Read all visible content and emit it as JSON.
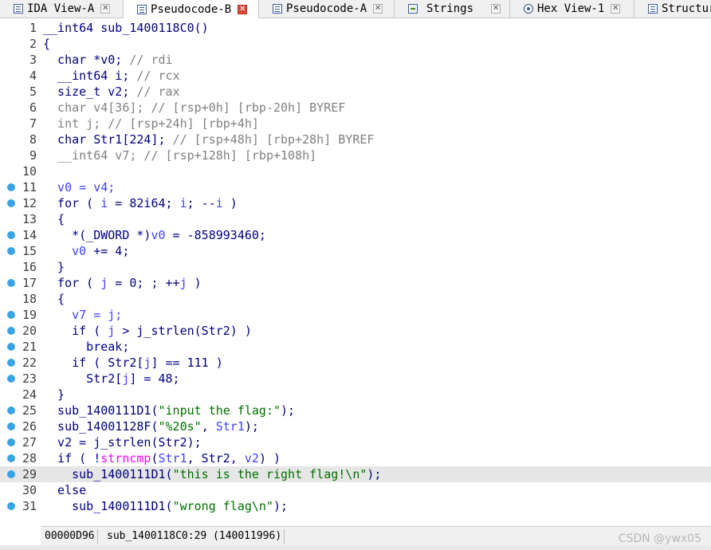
{
  "tabs": [
    {
      "label": "IDA View-A",
      "icon": "listing-icon",
      "active": false
    },
    {
      "label": "Pseudocode-B",
      "icon": "pseudocode-icon",
      "active": true
    },
    {
      "label": "Pseudocode-A",
      "icon": "pseudocode-icon",
      "active": false
    },
    {
      "label": "Strings",
      "icon": "strings-icon",
      "active": false
    },
    {
      "label": "Hex View-1",
      "icon": "hex-icon",
      "active": false
    },
    {
      "label": "Structur",
      "icon": "structures-icon",
      "active": false
    }
  ],
  "colors": {
    "keyword": "#000080",
    "comment": "#808080",
    "variable": "#4040ff",
    "string": "#007000",
    "imported": "#ff00ff",
    "breakpoint": "#3aa3e3",
    "current_line": "#e6e6e6"
  },
  "lines": [
    {
      "n": "1",
      "bp": false,
      "cur": false,
      "tokens": [
        [
          "k",
          "__int64 sub_1400118C0()"
        ]
      ]
    },
    {
      "n": "2",
      "bp": false,
      "cur": false,
      "tokens": [
        [
          "k",
          "{"
        ]
      ]
    },
    {
      "n": "3",
      "bp": false,
      "cur": false,
      "tokens": [
        [
          "k",
          "  char *v0; "
        ],
        [
          "g",
          "// rdi"
        ]
      ]
    },
    {
      "n": "4",
      "bp": false,
      "cur": false,
      "tokens": [
        [
          "k",
          "  __int64 i; "
        ],
        [
          "g",
          "// rcx"
        ]
      ]
    },
    {
      "n": "5",
      "bp": false,
      "cur": false,
      "tokens": [
        [
          "k",
          "  size_t v2; "
        ],
        [
          "g",
          "// rax"
        ]
      ]
    },
    {
      "n": "6",
      "bp": false,
      "cur": false,
      "tokens": [
        [
          "g",
          "  char v4[36]; // [rsp+0h] [rbp-20h] BYREF"
        ]
      ]
    },
    {
      "n": "7",
      "bp": false,
      "cur": false,
      "tokens": [
        [
          "g",
          "  int j; // [rsp+24h] [rbp+4h]"
        ]
      ]
    },
    {
      "n": "8",
      "bp": false,
      "cur": false,
      "tokens": [
        [
          "k",
          "  char Str1[224]; "
        ],
        [
          "g",
          "// [rsp+48h] [rbp+28h] BYREF"
        ]
      ]
    },
    {
      "n": "9",
      "bp": false,
      "cur": false,
      "tokens": [
        [
          "g",
          "  __int64 v7; // [rsp+128h] [rbp+108h]"
        ]
      ]
    },
    {
      "n": "10",
      "bp": false,
      "cur": false,
      "tokens": []
    },
    {
      "n": "11",
      "bp": true,
      "cur": false,
      "tokens": [
        [
          "v",
          "  v0 = v4;"
        ]
      ]
    },
    {
      "n": "12",
      "bp": true,
      "cur": false,
      "tokens": [
        [
          "k",
          "  for ( "
        ],
        [
          "v",
          "i"
        ],
        [
          "k",
          " = 82i64; "
        ],
        [
          "v",
          "i"
        ],
        [
          "k",
          "; --"
        ],
        [
          "v",
          "i"
        ],
        [
          "k",
          " )"
        ]
      ]
    },
    {
      "n": "13",
      "bp": false,
      "cur": false,
      "tokens": [
        [
          "k",
          "  {"
        ]
      ]
    },
    {
      "n": "14",
      "bp": true,
      "cur": false,
      "tokens": [
        [
          "k",
          "    *(_DWORD *)"
        ],
        [
          "v",
          "v0"
        ],
        [
          "k",
          " = -858993460;"
        ]
      ]
    },
    {
      "n": "15",
      "bp": true,
      "cur": false,
      "tokens": [
        [
          "v",
          "    v0"
        ],
        [
          "k",
          " += 4;"
        ]
      ]
    },
    {
      "n": "16",
      "bp": false,
      "cur": false,
      "tokens": [
        [
          "k",
          "  }"
        ]
      ]
    },
    {
      "n": "17",
      "bp": true,
      "cur": false,
      "tokens": [
        [
          "k",
          "  for ( "
        ],
        [
          "v",
          "j"
        ],
        [
          "k",
          " = 0; ; ++"
        ],
        [
          "v",
          "j"
        ],
        [
          "k",
          " )"
        ]
      ]
    },
    {
      "n": "18",
      "bp": false,
      "cur": false,
      "tokens": [
        [
          "k",
          "  {"
        ]
      ]
    },
    {
      "n": "19",
      "bp": true,
      "cur": false,
      "tokens": [
        [
          "v",
          "    v7 = j;"
        ]
      ]
    },
    {
      "n": "20",
      "bp": true,
      "cur": false,
      "tokens": [
        [
          "k",
          "    if ( "
        ],
        [
          "v",
          "j"
        ],
        [
          "k",
          " > j_strlen(Str2) )"
        ]
      ]
    },
    {
      "n": "21",
      "bp": true,
      "cur": false,
      "tokens": [
        [
          "k",
          "      break;"
        ]
      ]
    },
    {
      "n": "22",
      "bp": true,
      "cur": false,
      "tokens": [
        [
          "k",
          "    if ( Str2["
        ],
        [
          "v",
          "j"
        ],
        [
          "k",
          "] == 111 )"
        ]
      ]
    },
    {
      "n": "23",
      "bp": true,
      "cur": false,
      "tokens": [
        [
          "k",
          "      Str2["
        ],
        [
          "v",
          "j"
        ],
        [
          "k",
          "] = 48;"
        ]
      ]
    },
    {
      "n": "24",
      "bp": false,
      "cur": false,
      "tokens": [
        [
          "k",
          "  }"
        ]
      ]
    },
    {
      "n": "25",
      "bp": true,
      "cur": false,
      "tokens": [
        [
          "k",
          "  sub_1400111D1("
        ],
        [
          "s",
          "\"input the flag:\""
        ],
        [
          "k",
          ");"
        ]
      ]
    },
    {
      "n": "26",
      "bp": true,
      "cur": false,
      "tokens": [
        [
          "k",
          "  sub_14001128F("
        ],
        [
          "s",
          "\"%20s\""
        ],
        [
          "k",
          ", "
        ],
        [
          "v",
          "Str1"
        ],
        [
          "k",
          ");"
        ]
      ]
    },
    {
      "n": "27",
      "bp": true,
      "cur": false,
      "tokens": [
        [
          "k",
          "  v2 = j_strlen(Str2);"
        ]
      ]
    },
    {
      "n": "28",
      "bp": true,
      "cur": false,
      "tokens": [
        [
          "k",
          "  if ( !"
        ],
        [
          "m",
          "strncmp"
        ],
        [
          "k",
          "("
        ],
        [
          "v",
          "Str1"
        ],
        [
          "k",
          ", Str2, "
        ],
        [
          "v",
          "v2"
        ],
        [
          "k",
          ") )"
        ]
      ]
    },
    {
      "n": "29",
      "bp": true,
      "cur": true,
      "tokens": [
        [
          "k",
          "    sub_1400111D1("
        ],
        [
          "s",
          "\"this is the right flag!\\n\""
        ],
        [
          "k",
          ");"
        ]
      ]
    },
    {
      "n": "30",
      "bp": false,
      "cur": false,
      "tokens": [
        [
          "k",
          "  else"
        ]
      ]
    },
    {
      "n": "31",
      "bp": true,
      "cur": false,
      "tokens": [
        [
          "k",
          "    sub_1400111D1("
        ],
        [
          "s",
          "\"wrong flag\\n\""
        ],
        [
          "k",
          ");"
        ]
      ]
    }
  ],
  "status": {
    "address": "00000D96",
    "location": "sub_1400118C0:29 (140011996)"
  },
  "watermark": "CSDN @ywx05"
}
